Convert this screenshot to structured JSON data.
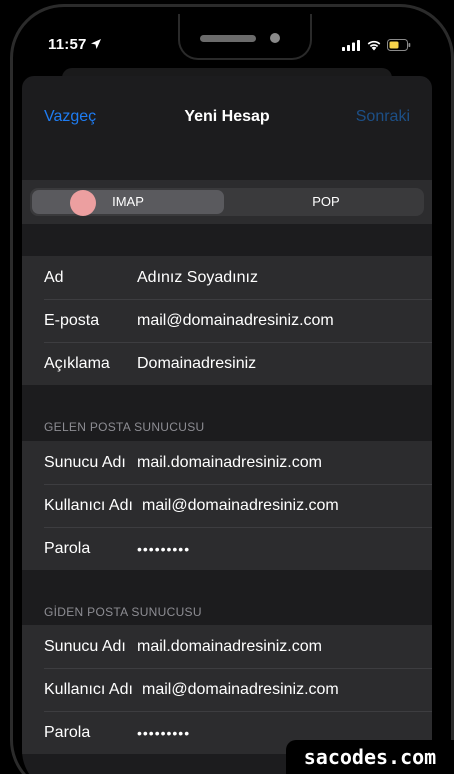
{
  "status_bar": {
    "time": "11:57",
    "battery_color": "#f5d24a"
  },
  "nav": {
    "cancel_label": "Vazgeç",
    "title": "Yeni Hesap",
    "next_label": "Sonraki"
  },
  "segment": {
    "options": [
      "IMAP",
      "POP"
    ],
    "selected": "IMAP"
  },
  "account": {
    "rows": [
      {
        "label": "Ad",
        "value": "Adınız Soyadınız"
      },
      {
        "label": "E-posta",
        "value": "mail@domainadresiniz.com"
      },
      {
        "label": "Açıklama",
        "value": "Domainadresiniz"
      }
    ]
  },
  "incoming": {
    "header": "GELEN POSTA SUNUCUSU",
    "rows": [
      {
        "label": "Sunucu Adı",
        "value": "mail.domainadresiniz.com"
      },
      {
        "label": "Kullanıcı Adı",
        "value": "mail@domainadresiniz.com"
      },
      {
        "label": "Parola",
        "value": "•••••••••"
      }
    ]
  },
  "outgoing": {
    "header": "GİDEN POSTA SUNUCUSU",
    "rows": [
      {
        "label": "Sunucu Adı",
        "value": "mail.domainadresiniz.com"
      },
      {
        "label": "Kullanıcı Adı",
        "value": "mail@domainadresiniz.com"
      },
      {
        "label": "Parola",
        "value": "•••••••••"
      }
    ]
  },
  "watermark": "sacodes.com",
  "colors": {
    "accent": "#1e7cf2",
    "accent_disabled": "#1c4f86",
    "background": "#1c1c1e",
    "cell": "#2c2c2e"
  }
}
